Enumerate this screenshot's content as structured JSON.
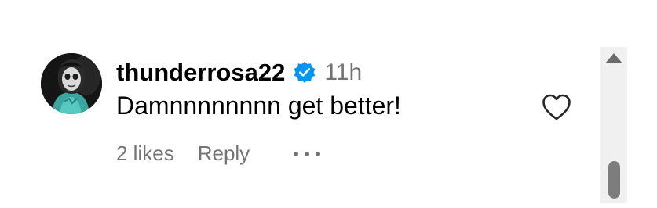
{
  "comment": {
    "username": "thunderrosa22",
    "verified_icon": "verified-badge-icon",
    "time": "11h",
    "text": "Damnnnnnnnn get better!",
    "likes": "2 likes",
    "reply_label": "Reply",
    "more_icon": "more-options-icon",
    "like_icon": "heart-outline-icon",
    "avatar": "profile-avatar"
  },
  "colors": {
    "username": "#000000",
    "secondary_text": "#737373",
    "verified_blue": "#0095f6",
    "scrollbar_track": "#f0f0f0",
    "scrollbar_thumb": "#7d7d7d"
  },
  "scrollbar": {
    "up_icon": "scroll-up-arrow-icon"
  }
}
